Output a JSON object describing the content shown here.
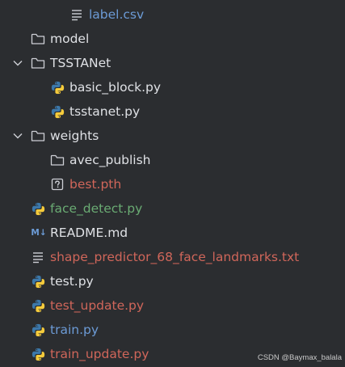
{
  "project_tree": {
    "items": [
      {
        "label": "label.csv",
        "icon": "text-file-icon",
        "color": "#6c9bd6"
      },
      {
        "label": "model",
        "icon": "folder-icon",
        "color": "#dfe1e5"
      },
      {
        "label": "TSSTANet",
        "icon": "folder-icon",
        "color": "#dfe1e5",
        "expanded": true
      },
      {
        "label": "basic_block.py",
        "icon": "python-file-icon",
        "color": "#dfe1e5"
      },
      {
        "label": "tsstanet.py",
        "icon": "python-file-icon",
        "color": "#dfe1e5"
      },
      {
        "label": "weights",
        "icon": "folder-icon",
        "color": "#dfe1e5",
        "expanded": true
      },
      {
        "label": "avec_publish",
        "icon": "folder-icon",
        "color": "#dfe1e5"
      },
      {
        "label": "best.pth",
        "icon": "unknown-file-icon",
        "color": "#d0665a"
      },
      {
        "label": "face_detect.py",
        "icon": "python-file-icon",
        "color": "#6aab73"
      },
      {
        "label": "README.md",
        "icon": "markdown-file-icon",
        "color": "#dfe1e5"
      },
      {
        "label": "shape_predictor_68_face_landmarks.txt",
        "icon": "text-file-icon",
        "color": "#d0665a"
      },
      {
        "label": "test.py",
        "icon": "python-file-icon",
        "color": "#dfe1e5"
      },
      {
        "label": "test_update.py",
        "icon": "python-file-icon",
        "color": "#d0665a"
      },
      {
        "label": "train.py",
        "icon": "python-file-icon",
        "color": "#6c9bd6"
      },
      {
        "label": "train_update.py",
        "icon": "python-file-icon",
        "color": "#d0665a"
      }
    ],
    "markdown_badge": "M↓"
  },
  "watermark": "CSDN @Baymax_balala",
  "colors": {
    "background": "#2b2d30",
    "text_default": "#dfe1e5",
    "vcs_modified": "#6c9bd6",
    "vcs_unversioned": "#d0665a",
    "vcs_added": "#6aab73",
    "python_blue": "#3c78aa",
    "python_yellow": "#f5cb3c"
  }
}
